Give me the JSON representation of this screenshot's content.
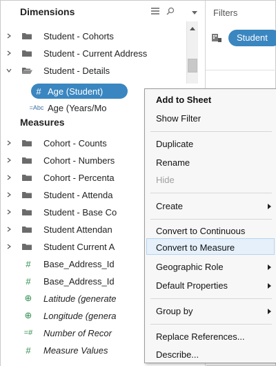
{
  "data_pane": {
    "dimensions_title": "Dimensions",
    "header_icons": [
      "list-view-icon",
      "search-icon"
    ],
    "dimension_rows": [
      {
        "label": "Student - Cohorts",
        "expanded": false
      },
      {
        "label": "Student - Current Address",
        "expanded": false
      },
      {
        "label": "Student - Details",
        "expanded": true
      }
    ],
    "detail_fields": [
      {
        "icon": "#",
        "label": "Age (Student)",
        "selected": true
      },
      {
        "icon": "=Abc",
        "label": "Age (Years/Mo"
      }
    ],
    "measures_title": "Measures",
    "measure_folders": [
      "Cohort - Counts",
      "Cohort - Numbers",
      "Cohort - Percenta",
      "Student - Attenda",
      "Student - Base Co",
      "Student Attendan",
      "Student Current A"
    ],
    "measure_fields": [
      {
        "icon": "#",
        "label": "Base_Address_Id",
        "italic": false
      },
      {
        "icon": "#",
        "label": "Base_Address_Id",
        "italic": false
      },
      {
        "icon": "⊕",
        "label": "Latitude (generate",
        "italic": true
      },
      {
        "icon": "⊕",
        "label": "Longitude (genera",
        "italic": true
      },
      {
        "icon": "=#",
        "label": "Number of Recor",
        "italic": true
      },
      {
        "icon": "#",
        "label": "Measure Values",
        "italic": true
      }
    ]
  },
  "shelves": {
    "filters_label": "Filters",
    "filter_pill": "Student"
  },
  "context_menu": {
    "items": [
      {
        "label": "Add to Sheet",
        "bold": true
      },
      {
        "label": "Show Filter"
      },
      {
        "label": "Duplicate"
      },
      {
        "label": "Rename"
      },
      {
        "label": "Hide",
        "disabled": true
      },
      {
        "label": "Create",
        "submenu": true
      },
      {
        "label": "Convert to Continuous"
      },
      {
        "label": "Convert to Measure",
        "highlighted": true
      },
      {
        "label": "Geographic Role",
        "submenu": true
      },
      {
        "label": "Default Properties",
        "submenu": true
      },
      {
        "label": "Group by",
        "submenu": true
      },
      {
        "label": "Replace References..."
      },
      {
        "label": "Describe..."
      }
    ]
  },
  "colors": {
    "pill_blue": "#3a86c0",
    "measure_green": "#2f8f4e",
    "dimension_blue": "#3a6ea5",
    "menu_highlight": "#e5f0fb"
  }
}
